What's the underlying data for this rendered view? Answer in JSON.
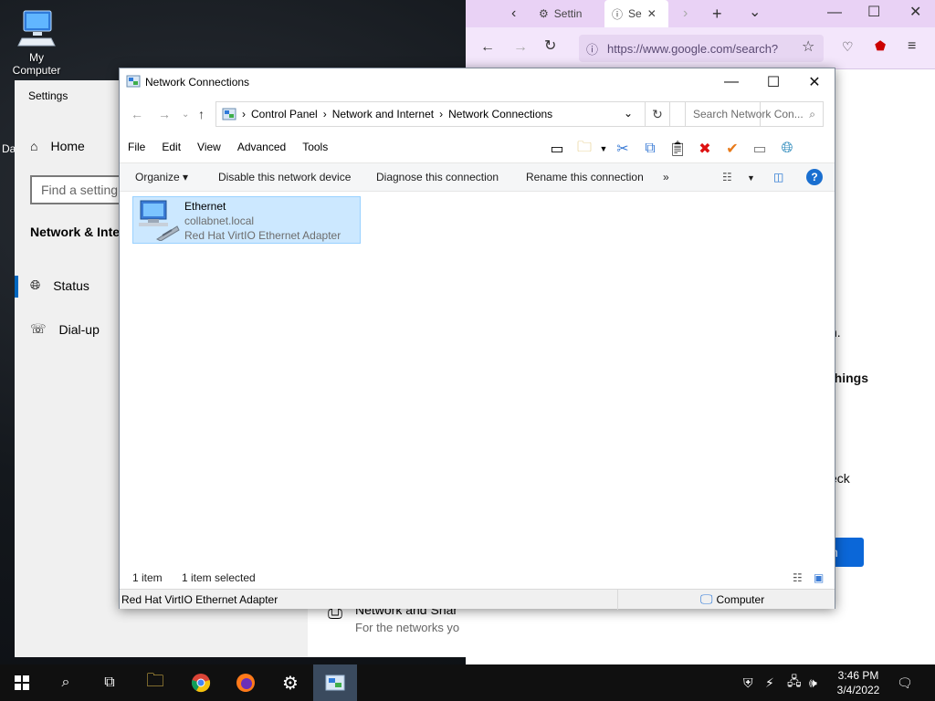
{
  "desktop": {
    "icon_label": "My Computer",
    "clipped_label": "Da"
  },
  "browser": {
    "tab1_label": "Settin",
    "tab2_label": "Se",
    "url": "https://www.google.com/search?",
    "fragments": {
      "f1": "n.",
      "f2": "things",
      "f3": "eck",
      "f4": ".",
      "button": "n"
    }
  },
  "settings": {
    "title": "Settings",
    "home_label": "Home",
    "search_placeholder": "Find a setting",
    "category": "Network & Inte",
    "items": [
      {
        "label": "Status"
      },
      {
        "label": "Dial-up"
      }
    ],
    "main_row": {
      "title": "Network and Shar",
      "subtitle": "For the networks yo"
    }
  },
  "explorer": {
    "title": "Network Connections",
    "address": {
      "crumbs": [
        "Control Panel",
        "Network and Internet",
        "Network Connections"
      ]
    },
    "search_placeholder": "Search Network Con...",
    "menu": [
      "File",
      "Edit",
      "View",
      "Advanced",
      "Tools"
    ],
    "commands": {
      "organize": "Organize",
      "disable": "Disable this network device",
      "diagnose": "Diagnose this connection",
      "rename": "Rename this connection",
      "more": "»"
    },
    "item": {
      "name": "Ethernet",
      "network": "collabnet.local",
      "adapter": "Red Hat VirtIO Ethernet Adapter"
    },
    "status": {
      "count": "1 item",
      "selected": "1 item selected"
    },
    "details": {
      "left": "Red Hat VirtIO Ethernet Adapter",
      "right": "Computer"
    }
  },
  "taskbar": {
    "time": "3:46 PM",
    "date": "3/4/2022"
  },
  "colors": {
    "accent": "#0067c0",
    "selection": "#cce8ff",
    "browser_tabs": "#e9d2f5",
    "taskbar": "#101010"
  }
}
